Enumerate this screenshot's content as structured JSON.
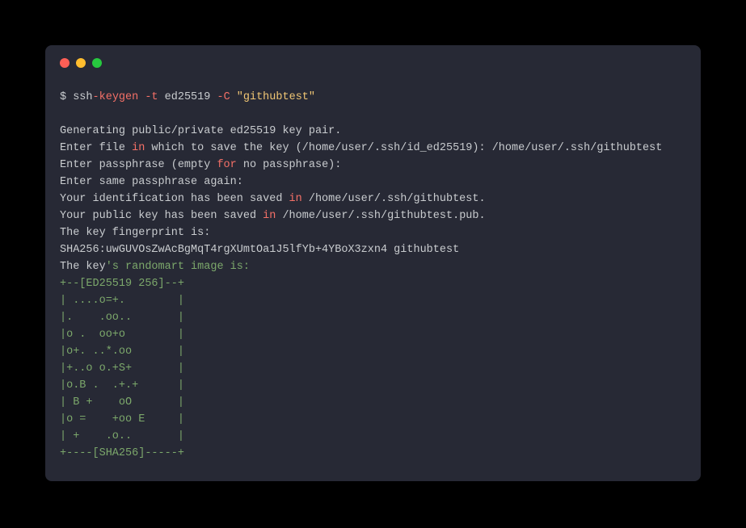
{
  "command": {
    "prompt": "$ ssh",
    "dash1": "-",
    "keygen": "keygen",
    "flag_t": " -t",
    "edalg": " ed25519 ",
    "flag_c": "-C",
    "space": " ",
    "comment": "\"githubtest\""
  },
  "output": {
    "blank1": "",
    "line1": "Generating public/private ed25519 key pair.",
    "line2_pre": "Enter file ",
    "line2_kw": "in",
    "line2_post": " which to save the key (/home/user/.ssh/id_ed25519): /home/user/.ssh/githubtest",
    "line3_pre": "Enter passphrase (empty ",
    "line3_kw": "for",
    "line3_post": " no passphrase):",
    "line4": "Enter same passphrase again:",
    "line5_pre": "Your identification has been saved ",
    "line5_kw": "in",
    "line5_post": " /home/user/.ssh/githubtest.",
    "line6_pre": "Your public key has been saved ",
    "line6_kw": "in",
    "line6_post": " /home/user/.ssh/githubtest.pub.",
    "line7": "The key fingerprint is:",
    "line8": "SHA256:uwGUVOsZwAcBgMqT4rgXUmtOa1J5lfYb+4YBoX3zxn4 githubtest",
    "line9_pre": "The key",
    "line9_rest": "'s randomart image is:",
    "art01": "+--[ED25519 256]--+",
    "art02": "| ....o=+.        |",
    "art03": "|.    .oo..       |",
    "art04": "|o .  oo+o        |",
    "art05": "|o+. ..*.oo       |",
    "art06": "|+..o o.+S+       |",
    "art07": "|o.B .  .+.+      |",
    "art08": "| B +    oO       |",
    "art09": "|o =    +oo E     |",
    "art10": "| +    .o..       |",
    "art11": "+----[SHA256]-----+"
  }
}
